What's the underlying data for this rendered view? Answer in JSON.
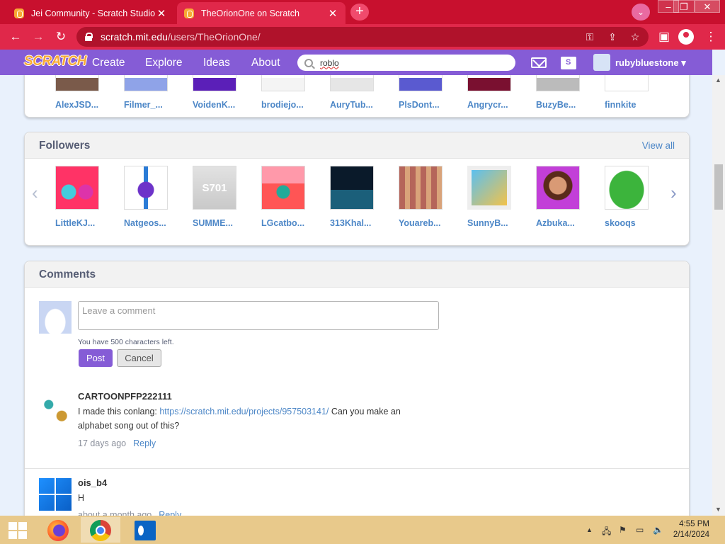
{
  "browser": {
    "tabs": [
      {
        "title": "Jei Community - Scratch Studio",
        "active": false
      },
      {
        "title": "TheOrionOne on Scratch",
        "active": true
      }
    ],
    "url_host": "scratch.mit.edu",
    "url_path": "/users/TheOrionOne/"
  },
  "scratch_nav": {
    "logo": "SCRATCH",
    "links": [
      "Create",
      "Explore",
      "Ideas",
      "About"
    ],
    "search_value": "roblo",
    "username": "rubybluestone"
  },
  "following": {
    "names": [
      "AlexJSD...",
      "Filmer_...",
      "VoidenK...",
      "brodiejo...",
      "AuryTub...",
      "PlsDont...",
      "Angrycr...",
      "BuzyBe...",
      "finnkite"
    ]
  },
  "followers": {
    "title": "Followers",
    "view_all": "View all",
    "names": [
      "LittleKJ...",
      "Natgeos...",
      "SUMME...",
      "LGcatbo...",
      "313Khal...",
      "Youareb...",
      "SunnyB...",
      "Azbuka...",
      "skooqs"
    ]
  },
  "comments": {
    "title": "Comments",
    "placeholder": "Leave a comment",
    "chars_left": "You have 500 characters left.",
    "post_label": "Post",
    "cancel_label": "Cancel",
    "reply_label": "Reply",
    "items": [
      {
        "user": "CARTOONPFP222111",
        "text_before": "I made this conlang: ",
        "link": "https://scratch.mit.edu/projects/957503141/",
        "text_after": " Can you make an alphabet song out of this?",
        "time": "17 days ago"
      },
      {
        "user": "ois_b4",
        "text": "H",
        "time": "about a month ago"
      }
    ]
  },
  "taskbar": {
    "time": "4:55 PM",
    "date": "2/14/2024"
  }
}
